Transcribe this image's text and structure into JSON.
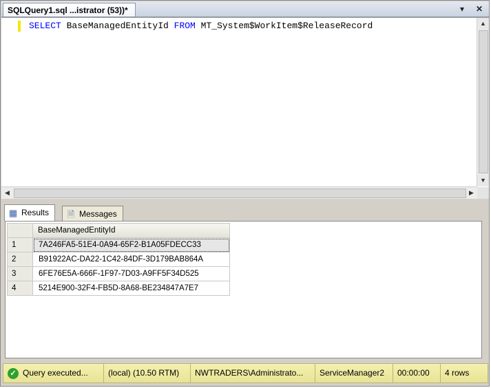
{
  "document_tab": {
    "title": "SQLQuery1.sql ...istrator (53))*"
  },
  "editor": {
    "tokens": [
      {
        "text": "SELECT",
        "kind": "keyword"
      },
      {
        "text": " BaseManagedEntityId ",
        "kind": "identifier"
      },
      {
        "text": "FROM",
        "kind": "keyword"
      },
      {
        "text": " MT_System$WorkItem$ReleaseRecord",
        "kind": "identifier"
      }
    ]
  },
  "results_tabs": [
    {
      "label": "Results",
      "icon": "results-grid-icon",
      "active": true
    },
    {
      "label": "Messages",
      "icon": "messages-icon",
      "active": false
    }
  ],
  "results_grid": {
    "columns": [
      "BaseManagedEntityId"
    ],
    "rows": [
      {
        "num": "1",
        "value": "7A246FA5-51E4-0A94-65F2-B1A05FDECC33",
        "selected": true
      },
      {
        "num": "2",
        "value": "B91922AC-DA22-1C42-84DF-3D179BAB864A",
        "selected": false
      },
      {
        "num": "3",
        "value": "6FE76E5A-666F-1F97-7D03-A9FF5F34D525",
        "selected": false
      },
      {
        "num": "4",
        "value": "5214E900-32F4-FB5D-8A68-BE234847A7E7",
        "selected": false
      }
    ]
  },
  "status_bar": {
    "query_status": "Query executed...",
    "server": "(local) (10.50 RTM)",
    "user": "NWTRADERS\\Administrato...",
    "database": "ServiceManager2",
    "elapsed": "00:00:00",
    "rows": "4 rows"
  },
  "colors": {
    "keyword": "#0000ff",
    "status_bar": "#f0ec9e",
    "status_ok": "#2fa12f"
  }
}
